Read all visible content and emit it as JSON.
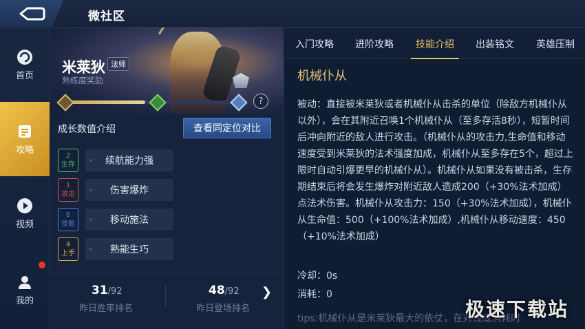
{
  "header": {
    "title": "微社区"
  },
  "nav": {
    "items": [
      {
        "label": "首页",
        "icon": "home-icon"
      },
      {
        "label": "攻略",
        "icon": "guide-icon",
        "active": true
      },
      {
        "label": "视频",
        "icon": "video-play-icon"
      },
      {
        "label": "我的",
        "icon": "user-icon",
        "badge": "red-dot"
      }
    ]
  },
  "hero": {
    "name": "米莱狄",
    "class": "法师",
    "reward": "熟练度奖励",
    "progress": 0.46
  },
  "growth": {
    "title": "成长数值介绍",
    "compare_button": "查看同定位对比",
    "stats": [
      {
        "rank": "2",
        "tag": "生存",
        "label": "续航能力强",
        "color": "#4fbf66"
      },
      {
        "rank": "1",
        "tag": "攻击",
        "label": "伤害爆炸",
        "color": "#e0533f"
      },
      {
        "rank": "8",
        "tag": "技能",
        "label": "移动施法",
        "color": "#4c7ee0"
      },
      {
        "rank": "4",
        "tag": "上手",
        "label": "熟能生巧",
        "color": "#d9a63f"
      }
    ]
  },
  "ranks": {
    "win": {
      "value": "31",
      "total": "/92",
      "label": "昨日胜率排名"
    },
    "appear": {
      "value": "48",
      "total": "/92",
      "label": "昨日登场排名"
    }
  },
  "tabs": [
    "入门攻略",
    "进阶攻略",
    "技能介绍",
    "出装铭文",
    "英雄压制"
  ],
  "active_tab": 2,
  "skill": {
    "name": "机械仆从",
    "description": "被动：直接被米莱狄或者机械仆从击杀的单位（除敌方机械仆从以外），会在其附近召唤1个机械仆从（至多存活8秒），短暂时间后冲向附近的敌人进行攻击。（机械仆从的攻击力,生命值和移动速度受到米莱狄的法术强度加成，机械仆从至多存在5个，超过上限时自动引爆更早的机械仆从）。机械仆从如果没有被击杀，生存期结束后将会发生爆炸对附近敌人造成200（+30%法术加成）点法术伤害。机械仆从攻击力：150（+30%法术加成），机械仆从生命值：500（+100%法术加成）,机械仆从移动速度：450（+10%法术加成）",
    "cooldown": "冷却：0s",
    "cost": "消耗：0",
    "tips": "tips:机械仆从是米莱狄最大的依仗，在对线或消耗时"
  },
  "watermark": "极速下载站"
}
